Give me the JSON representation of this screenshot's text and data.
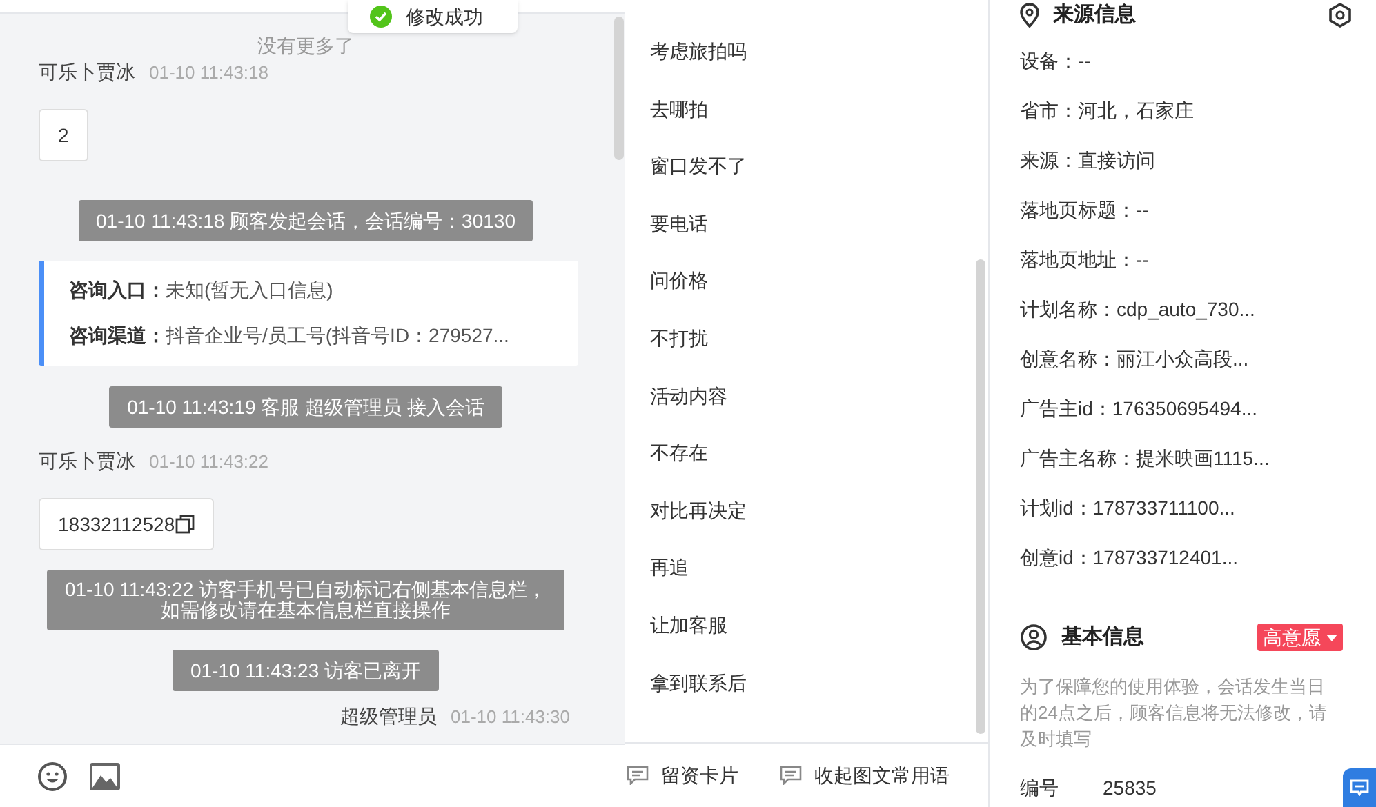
{
  "toast": {
    "text": "修改成功"
  },
  "chat": {
    "no_more": "没有更多了",
    "messages": [
      {
        "kind": "visitor",
        "sender": "可乐卜贾冰",
        "time": "01-10 11:43:18",
        "text": "2",
        "copy": false
      },
      {
        "kind": "system",
        "text": "01-10 11:43:18 顾客发起会话，会话编号：30130"
      },
      {
        "kind": "info",
        "rows": [
          {
            "label": "咨询入口：",
            "value": "未知(暂无入口信息)"
          },
          {
            "label": "咨询渠道：",
            "value": "抖音企业号/员工号(抖音号ID：279527..."
          }
        ]
      },
      {
        "kind": "system",
        "text": "01-10 11:43:19 客服 超级管理员 接入会话"
      },
      {
        "kind": "visitor",
        "sender": "可乐卜贾冰",
        "time": "01-10 11:43:22",
        "text": "18332112528",
        "copy": true
      },
      {
        "kind": "system",
        "lines": [
          "01-10 11:43:22 访客手机号已自动标记右侧基本信息栏，",
          "如需修改请在基本信息栏直接操作"
        ]
      },
      {
        "kind": "system",
        "text": "01-10 11:43:23 访客已离开"
      },
      {
        "kind": "agent",
        "sender": "超级管理员",
        "time": "01-10 11:43:30"
      }
    ]
  },
  "quick_replies": {
    "items": [
      "考虑旅拍吗",
      "去哪拍",
      "窗口发不了",
      "要电话",
      "问价格",
      "不打扰",
      "活动内容",
      "不存在",
      "对比再决定",
      "再追",
      "让加客服",
      "拿到联系后"
    ],
    "buttons": [
      "留资卡片",
      "收起图文常用语"
    ]
  },
  "source_info": {
    "title": "来源信息",
    "rows": [
      "设备：--",
      "省市：河北，石家庄",
      "来源：直接访问",
      "落地页标题：--",
      "落地页地址：--",
      "计划名称：cdp_auto_730...",
      "创意名称：丽江小众高段...",
      "广告主id：176350695494...",
      "广告主名称：提米映画1115...",
      "计划id：178733711100...",
      "创意id：178733712401..."
    ]
  },
  "basic_info": {
    "title": "基本信息",
    "intent": "高意愿",
    "note": "为了保障您的使用体验，会话发生当日的24点之后，顾客信息将无法修改，请及时填写",
    "fields": [
      {
        "label": "编号",
        "value": "25835"
      }
    ]
  }
}
